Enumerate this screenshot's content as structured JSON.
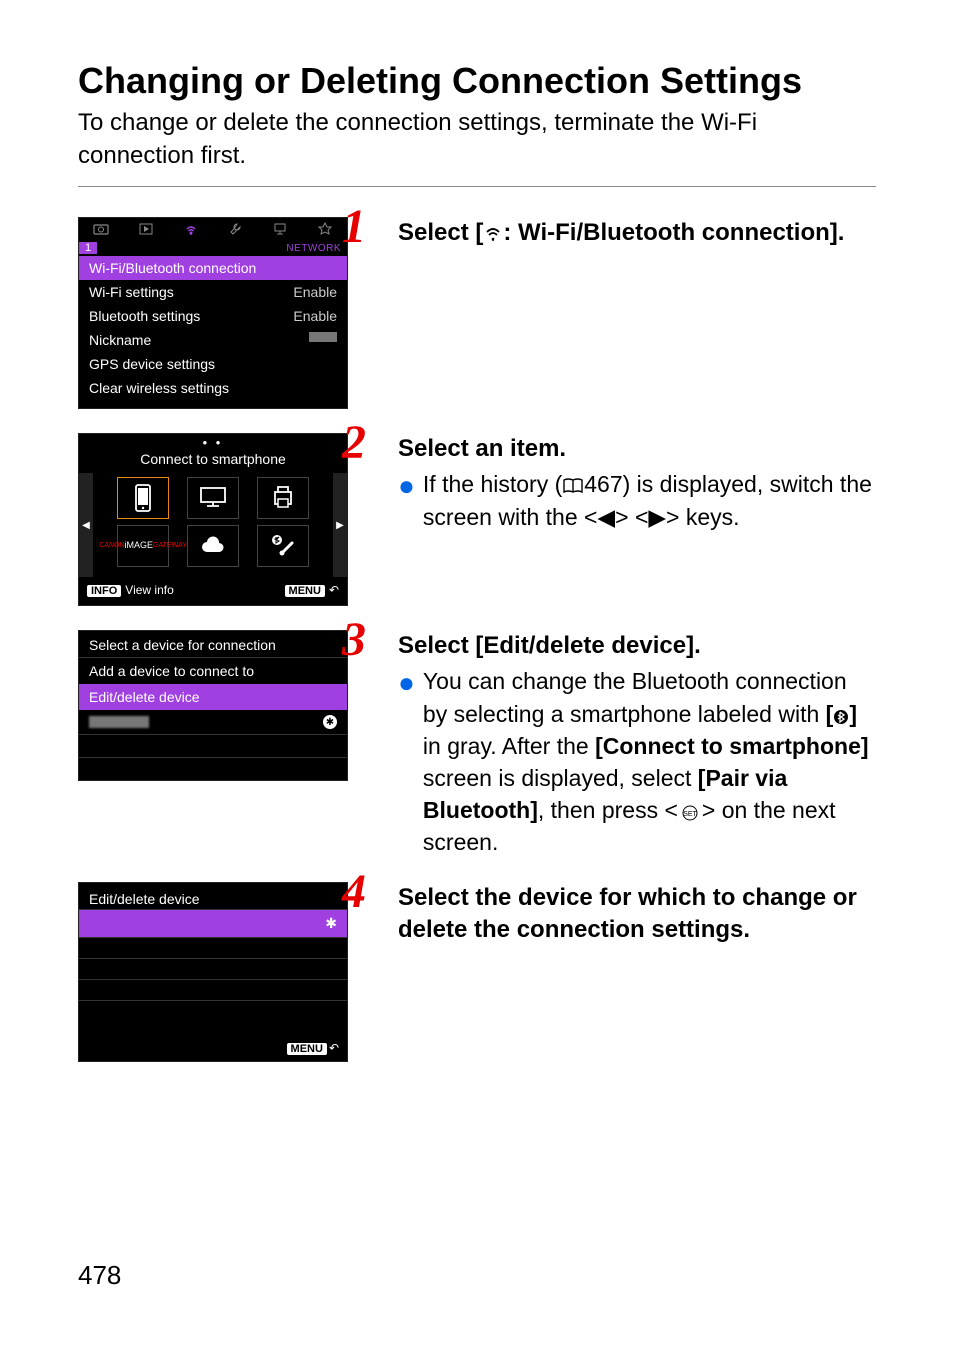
{
  "title": "Changing or Deleting Connection Settings",
  "intro": "To change or delete the connection settings, terminate the Wi-Fi connection first.",
  "page_number": "478",
  "shot1": {
    "subtab_num": "1",
    "subtab_label": "NETWORK",
    "rows": {
      "wifi_bt": "Wi-Fi/Bluetooth connection",
      "wifi_settings": "Wi-Fi settings",
      "wifi_settings_val": "Enable",
      "bt_settings": "Bluetooth settings",
      "bt_settings_val": "Enable",
      "nickname": "Nickname",
      "gps": "GPS device settings",
      "clear": "Clear wireless settings"
    }
  },
  "shot2": {
    "heading": "Connect to smartphone",
    "info_badge": "INFO",
    "info_text": "View info",
    "menu_badge": "MENU"
  },
  "shot3": {
    "heading": "Select a device for connection",
    "add": "Add a device to connect to",
    "edit": "Edit/delete device"
  },
  "shot4": {
    "heading": "Edit/delete device",
    "menu_badge": "MENU"
  },
  "steps": {
    "s1": {
      "num": "1",
      "title_pre": "Select [",
      "title_post": ": Wi-Fi/Bluetooth connection]."
    },
    "s2": {
      "num": "2",
      "title": "Select an item.",
      "bullet_pre": "If the history (",
      "bullet_ref": "467",
      "bullet_post": ") is displayed, switch the screen with the <◀> <▶> keys."
    },
    "s3": {
      "num": "3",
      "title": "Select [Edit/delete device].",
      "bullet_a": "You can change the Bluetooth connection by selecting a smartphone labeled with ",
      "bullet_b": " in gray. After the ",
      "bullet_c": "[Connect to smartphone]",
      "bullet_d": " screen is displayed, select ",
      "bullet_e": "[Pair via Bluetooth]",
      "bullet_f": ", then press <",
      "bullet_g": "> on the next screen."
    },
    "s4": {
      "num": "4",
      "title": "Select the device for which to change or delete the connection settings."
    }
  }
}
